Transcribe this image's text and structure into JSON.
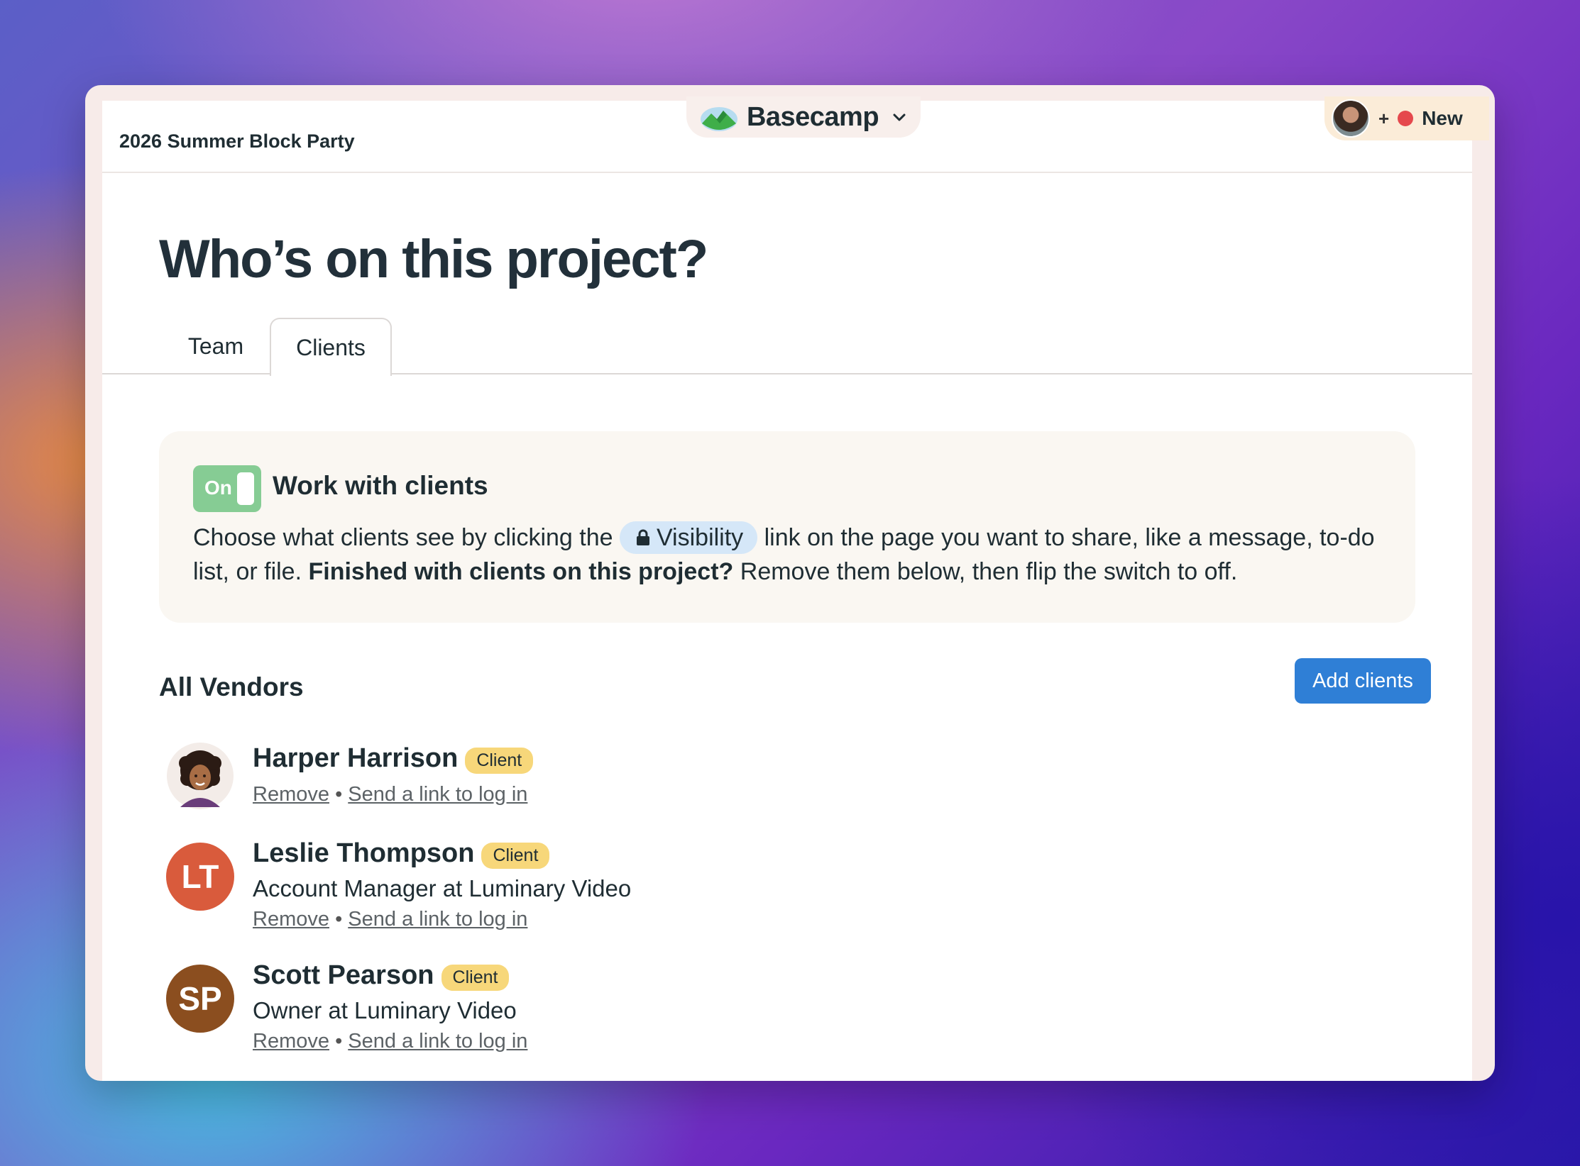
{
  "header": {
    "project_name": "2026 Summer Block Party",
    "app_name": "Basecamp",
    "plus": "+",
    "new_label": "New"
  },
  "page": {
    "title": "Who’s on this project?",
    "tabs": [
      {
        "label": "Team",
        "active": false
      },
      {
        "label": "Clients",
        "active": true
      }
    ]
  },
  "info": {
    "toggle_label": "On",
    "toggle_state": "on",
    "heading": "Work with clients",
    "text_part1": "Choose what clients see by clicking the ",
    "visibility_label": "Visibility",
    "text_part2": " link on the page you want to share, like a message, to-do list, or file. ",
    "text_bold": "Finished with clients on this project?",
    "text_part3": " Remove them below, then flip the switch to off."
  },
  "vendors": {
    "title": "All Vendors",
    "add_button": "Add clients",
    "people": [
      {
        "name": "Harper Harrison",
        "badge": "Client",
        "role": "",
        "initials": "",
        "remove": "Remove",
        "separator": "•",
        "login_link": "Send a link to log in"
      },
      {
        "name": "Leslie Thompson",
        "badge": "Client",
        "role": "Account Manager at Luminary Video",
        "initials": "LT",
        "color": "#d95b3c",
        "remove": "Remove",
        "separator": "•",
        "login_link": "Send a link to log in"
      },
      {
        "name": "Scott Pearson",
        "badge": "Client",
        "role": "Owner at Luminary Video",
        "initials": "SP",
        "color": "#8b4e1f",
        "remove": "Remove",
        "separator": "•",
        "login_link": "Send a link to log in"
      }
    ]
  }
}
